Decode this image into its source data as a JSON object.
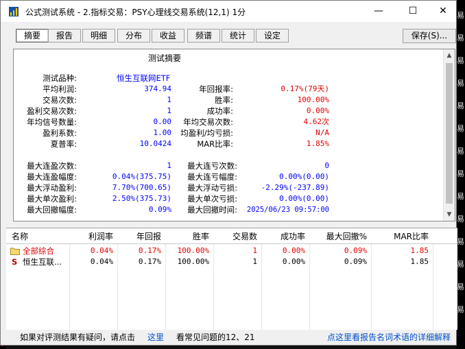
{
  "window": {
    "title": "公式测试系统 - 2.指标交易：PSY心理线交易系统(12,1) 1分",
    "min": "—",
    "max": "☐",
    "close": "✕"
  },
  "tabs": [
    "摘要",
    "报告",
    "明细",
    "分布",
    "收益",
    "频谱",
    "统计",
    "设定"
  ],
  "save_button": "保存(S)...",
  "summary": {
    "title": "测试摘要",
    "left": [
      {
        "label": "测试品种:",
        "value": "恒生互联网ETF",
        "color": "#0000ff"
      },
      {
        "label": "平均利润:",
        "value": "374.94",
        "color": "#0000ff"
      },
      {
        "label": "交易次数:",
        "value": "1",
        "color": "#0000ff"
      },
      {
        "label": "盈利交易次数:",
        "value": "1",
        "color": "#0000ff"
      },
      {
        "label": "年均信号数量:",
        "value": "0.00",
        "color": "#0000ff"
      },
      {
        "label": "盈利系数:",
        "value": "1.00",
        "color": "#0000ff"
      },
      {
        "label": "夏普率:",
        "value": "10.0424",
        "color": "#0000ff"
      }
    ],
    "right": [
      {
        "label": "年回报率:",
        "value": "0.17%(79天)",
        "color": "#e00000"
      },
      {
        "label": "胜率:",
        "value": "100.00%",
        "color": "#e00000"
      },
      {
        "label": "成功率:",
        "value": "0.00%",
        "color": "#e00000"
      },
      {
        "label": "年均交易次数:",
        "value": "4.62次",
        "color": "#e00000"
      },
      {
        "label": "均盈利/均亏损:",
        "value": "N/A",
        "color": "#e00000"
      },
      {
        "label": "MAR比率:",
        "value": "1.85%",
        "color": "#e00000"
      }
    ],
    "left2": [
      {
        "label": "最大连盈次数:",
        "value": "1"
      },
      {
        "label": "最大连盈幅度:",
        "value": "0.04%(375.75)"
      },
      {
        "label": "最大浮动盈利:",
        "value": "7.70%(700.65)"
      },
      {
        "label": "最大单次盈利:",
        "value": "2.50%(375.73)"
      },
      {
        "label": "最大回撤幅度:",
        "value": "0.09%"
      }
    ],
    "right2": [
      {
        "label": "最大连亏次数:",
        "value": "0"
      },
      {
        "label": "最大连亏幅度:",
        "value": "0.00%(0.00)"
      },
      {
        "label": "最大浮动亏损:",
        "value": "-2.29%(-237.89)"
      },
      {
        "label": "最大单次亏损:",
        "value": "0.00%(0.00)"
      },
      {
        "label": "最大回撤时间:",
        "value": "2025/06/23 09:57:00"
      }
    ]
  },
  "table": {
    "headers": [
      "名称",
      "利润率",
      "年回报",
      "胜率",
      "交易数",
      "成功率",
      "最大回撤%",
      "MAR比率"
    ],
    "rows": [
      {
        "icon": "folder-icon",
        "name": "全部综合",
        "profit": "0.04%",
        "annual": "0.17%",
        "win": "100.00%",
        "trades": "1",
        "success": "0.00%",
        "drawdown": "0.09%",
        "mar": "1.85",
        "color": "#e00000"
      },
      {
        "icon": "stock-s-icon",
        "name": "恒生互联...",
        "profit": "0.04%",
        "annual": "0.17%",
        "win": "100.00%",
        "trades": "1",
        "success": "0.00%",
        "drawdown": "0.09%",
        "mar": "1.85",
        "color": "#000000"
      }
    ]
  },
  "status": {
    "text1": "如果对评测结果有疑问，请点击",
    "link1": "这里",
    "text2": "看常见问题的12、21",
    "link2": "点这里看报告名词术语的详细解释"
  },
  "background_strip": [
    "易",
    "易",
    "易",
    "易",
    "易",
    "易",
    "易",
    "易",
    "易",
    "易",
    "易",
    "易",
    "易",
    "易"
  ]
}
